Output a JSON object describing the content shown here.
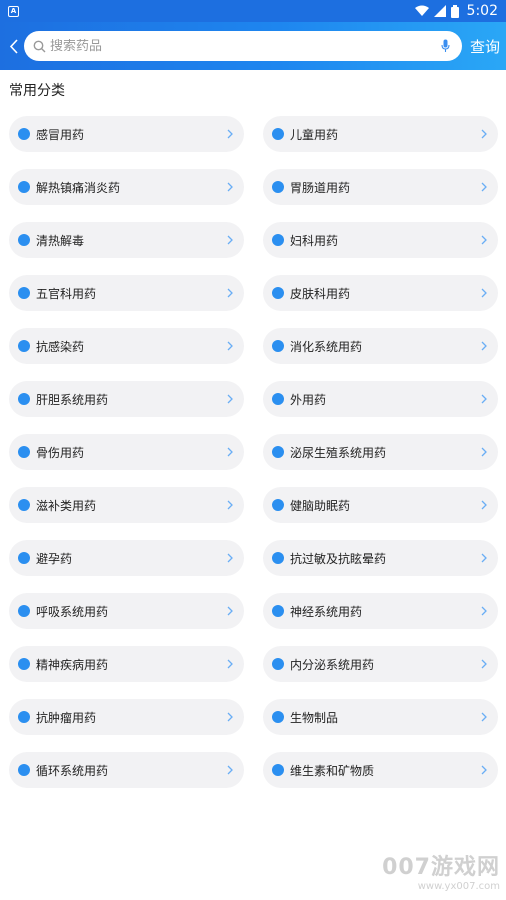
{
  "status_bar": {
    "time": "5:02",
    "app_badge": "A",
    "icons": [
      "wifi-icon",
      "signal-icon",
      "battery-icon"
    ]
  },
  "header": {
    "search_placeholder": "搜索药品",
    "query_label": "查询",
    "icons": [
      "back-icon",
      "search-icon",
      "mic-icon"
    ]
  },
  "section_title": "常用分类",
  "categories": [
    "感冒用药",
    "儿童用药",
    "解热镇痛消炎药",
    "胃肠道用药",
    "清热解毒",
    "妇科用药",
    "五官科用药",
    "皮肤科用药",
    "抗感染药",
    "消化系统用药",
    "肝胆系统用药",
    "外用药",
    "骨伤用药",
    "泌尿生殖系统用药",
    "滋补类用药",
    "健脑助眠药",
    "避孕药",
    "抗过敏及抗眩晕药",
    "呼吸系统用药",
    "神经系统用药",
    "精神疾病用药",
    "内分泌系统用药",
    "抗肿瘤用药",
    "生物制品",
    "循环系统用药",
    "维生素和矿物质"
  ],
  "colors": {
    "header_start": "#1d6fe0",
    "header_end": "#2aa7f6",
    "dot": "#2b8ff0",
    "card_bg": "#f2f2f4"
  },
  "watermark": {
    "main": "007游戏网",
    "sub": "www.yx007.com"
  }
}
